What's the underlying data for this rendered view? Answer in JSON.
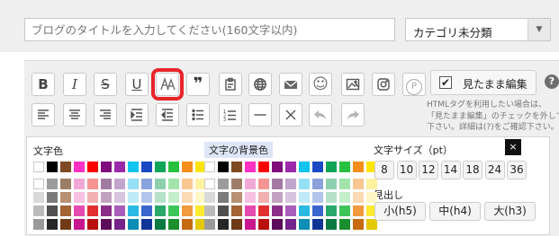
{
  "title_input": {
    "placeholder": "ブログのタイトルを入力してください(160文字以内)"
  },
  "category": {
    "value": "カテゴリ未分類"
  },
  "toolbar_row1": [
    {
      "name": "bold-button",
      "icon": "bold-icon",
      "glyph": "B"
    },
    {
      "name": "italic-button",
      "icon": "italic-icon",
      "glyph": "I"
    },
    {
      "name": "strikethrough-button",
      "icon": "strikethrough-icon",
      "glyph": "S"
    },
    {
      "name": "underline-button",
      "icon": "underline-icon",
      "glyph": "U"
    },
    {
      "name": "font-color-button",
      "icon": "font-color-icon",
      "glyph": "",
      "highlighted": true
    },
    {
      "name": "quote-button",
      "icon": "quote-icon",
      "glyph": "❞"
    },
    {
      "name": "paste-button",
      "icon": "clipboard-icon",
      "glyph": ""
    },
    {
      "name": "link-button",
      "icon": "globe-icon",
      "glyph": ""
    },
    {
      "name": "mail-button",
      "icon": "mail-icon",
      "glyph": ""
    },
    {
      "name": "emoji-button",
      "icon": "smiley-icon",
      "glyph": "☺"
    },
    {
      "name": "image-button",
      "icon": "image-icon",
      "glyph": ""
    },
    {
      "name": "instagram-button",
      "icon": "instagram-icon",
      "glyph": ""
    },
    {
      "name": "pinterest-button",
      "icon": "pinterest-icon",
      "glyph": "P"
    }
  ],
  "toolbar_row2": [
    {
      "name": "align-left-button",
      "icon": "align-left-icon"
    },
    {
      "name": "align-center-button",
      "icon": "align-center-icon"
    },
    {
      "name": "align-right-button",
      "icon": "align-right-icon"
    },
    {
      "name": "indent-button",
      "icon": "indent-icon"
    },
    {
      "name": "outdent-button",
      "icon": "outdent-icon"
    },
    {
      "name": "bullet-list-button",
      "icon": "bullet-list-icon"
    },
    {
      "name": "numbered-list-button",
      "icon": "numbered-list-icon"
    },
    {
      "name": "horizontal-rule-button",
      "icon": "horizontal-rule-icon"
    },
    {
      "name": "remove-format-button",
      "icon": "close-icon"
    },
    {
      "name": "undo-button",
      "icon": "undo-icon",
      "disabled": true
    },
    {
      "name": "redo-button",
      "icon": "redo-icon",
      "disabled": true
    }
  ],
  "mitamama": {
    "label": "見たまま編集",
    "checked": true,
    "check_glyph": "✔"
  },
  "help": {
    "glyph": "?"
  },
  "note_lines": [
    "HTMLタグを利用したい場合は、",
    "「見たまま編集」のチェックを外して",
    "下さい。詳細は(?)をご確認下さい。"
  ],
  "color_panel": {
    "text_color_title": "文字色",
    "bg_color_title": "文字の背景色",
    "font_size_title": "文字サイズ（pt）",
    "font_sizes": [
      "8",
      "10",
      "12",
      "14",
      "18",
      "24",
      "36"
    ],
    "heading_title": "見出し",
    "headings": [
      "小(h5)",
      "中(h4)",
      "大(h3)"
    ],
    "close_glyph": "×",
    "palette_rows": [
      [
        "#ffffff",
        "#000000",
        "#7f4a23",
        "#fe31c4",
        "#ff0000",
        "#7f0b7d",
        "#9a2aa8",
        "#10c4ee",
        "#1a49c4",
        "#0ea55a",
        "#26c23f",
        "#f58f1c",
        "#ffe600"
      ],
      [
        "#ffffff",
        "#9c9c9c",
        "#9e7d68",
        "#f1a8d6",
        "#f69393",
        "#a27aa1",
        "#c1a5cc",
        "#96e0f6",
        "#8aa3dc",
        "#8dd0ad",
        "#a2e4aa",
        "#f9c792",
        "#fff3a1"
      ],
      [
        "#d9d9d9",
        "#7b7b7b",
        "#b78f73",
        "#f6c1e2",
        "#f3b0b0",
        "#c2a2c1",
        "#d7c5e0",
        "#bfeaf8",
        "#b2c5ea",
        "#b5e1c8",
        "#c4eec9",
        "#fbdab6",
        "#fff7c4"
      ],
      [
        "#bbbbbb",
        "#505050",
        "#a46335",
        "#e54ab1",
        "#e12f2f",
        "#8c2e88",
        "#a85dba",
        "#2ab9e3",
        "#3a66cd",
        "#2aa86b",
        "#3ec557",
        "#ef9a3e",
        "#ffea30"
      ],
      [
        "#9a9a9a",
        "#262626",
        "#6f3a16",
        "#c8168f",
        "#b80f0f",
        "#5c0a5a",
        "#74248a",
        "#0e8eb4",
        "#0f3596",
        "#0b7a42",
        "#1b8e2d",
        "#c56a0e",
        "#e4c800"
      ]
    ]
  }
}
